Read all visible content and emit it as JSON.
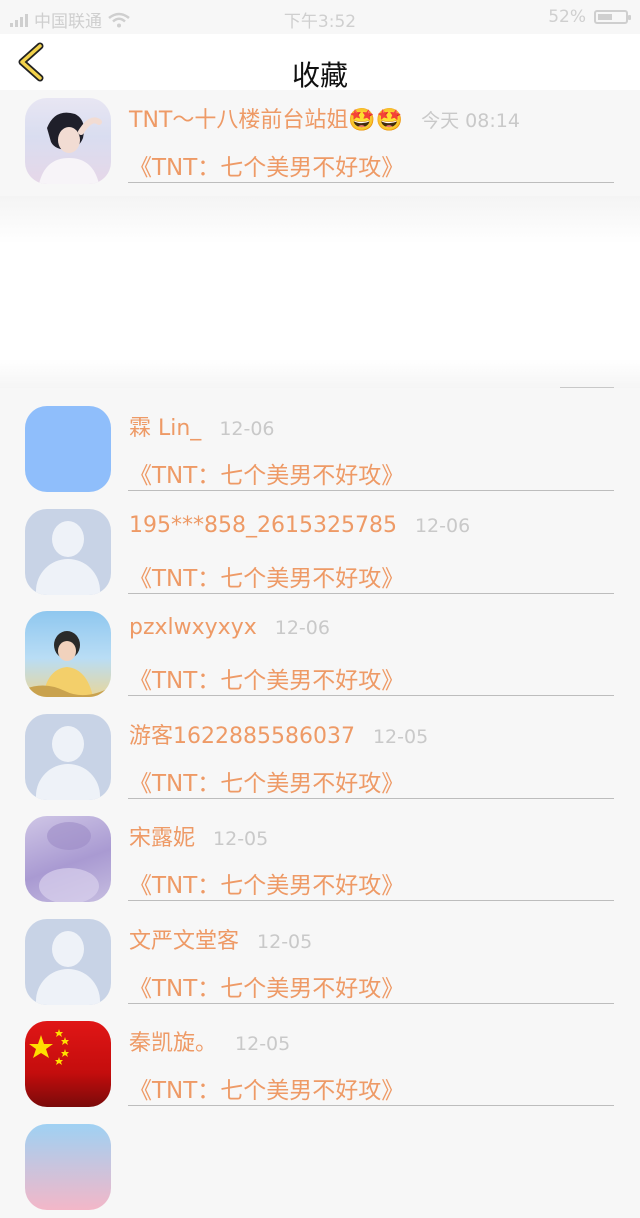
{
  "status_bar": {
    "carrier": "中国联通",
    "time": "下午3:52",
    "battery": "52%",
    "battery_level": 0.52
  },
  "header": {
    "title": "收藏"
  },
  "colors": {
    "accent": "#ee9a66",
    "date": "#c9c9c9",
    "background": "#f7f7f7"
  },
  "items": [
    {
      "name": "TNT～十八楼前台站姐🤩🤩",
      "date": "今天 08:14",
      "book": "《TNT：七个美男不好攻》",
      "avatar": "photo-boy-sky"
    },
    {
      "name": "霖 Lin_",
      "date": "12-06",
      "book": "《TNT：七个美男不好攻》",
      "avatar": "solid-blue"
    },
    {
      "name": "195***858_2615325785",
      "date": "12-06",
      "book": "《TNT：七个美男不好攻》",
      "avatar": "default-person"
    },
    {
      "name": "pzxlwxyxyx",
      "date": "12-06",
      "book": "《TNT：七个美男不好攻》",
      "avatar": "photo-boy-field"
    },
    {
      "name": "游客1622885586037",
      "date": "12-05",
      "book": "《TNT：七个美男不好攻》",
      "avatar": "default-person"
    },
    {
      "name": "宋露妮",
      "date": "12-05",
      "book": "《TNT：七个美男不好攻》",
      "avatar": "photo-purple"
    },
    {
      "name": "文严文堂客",
      "date": "12-05",
      "book": "《TNT：七个美男不好攻》",
      "avatar": "default-person"
    },
    {
      "name": "秦凯旋。",
      "date": "12-05",
      "book": "《TNT：七个美男不好攻》",
      "avatar": "flag-china"
    }
  ]
}
